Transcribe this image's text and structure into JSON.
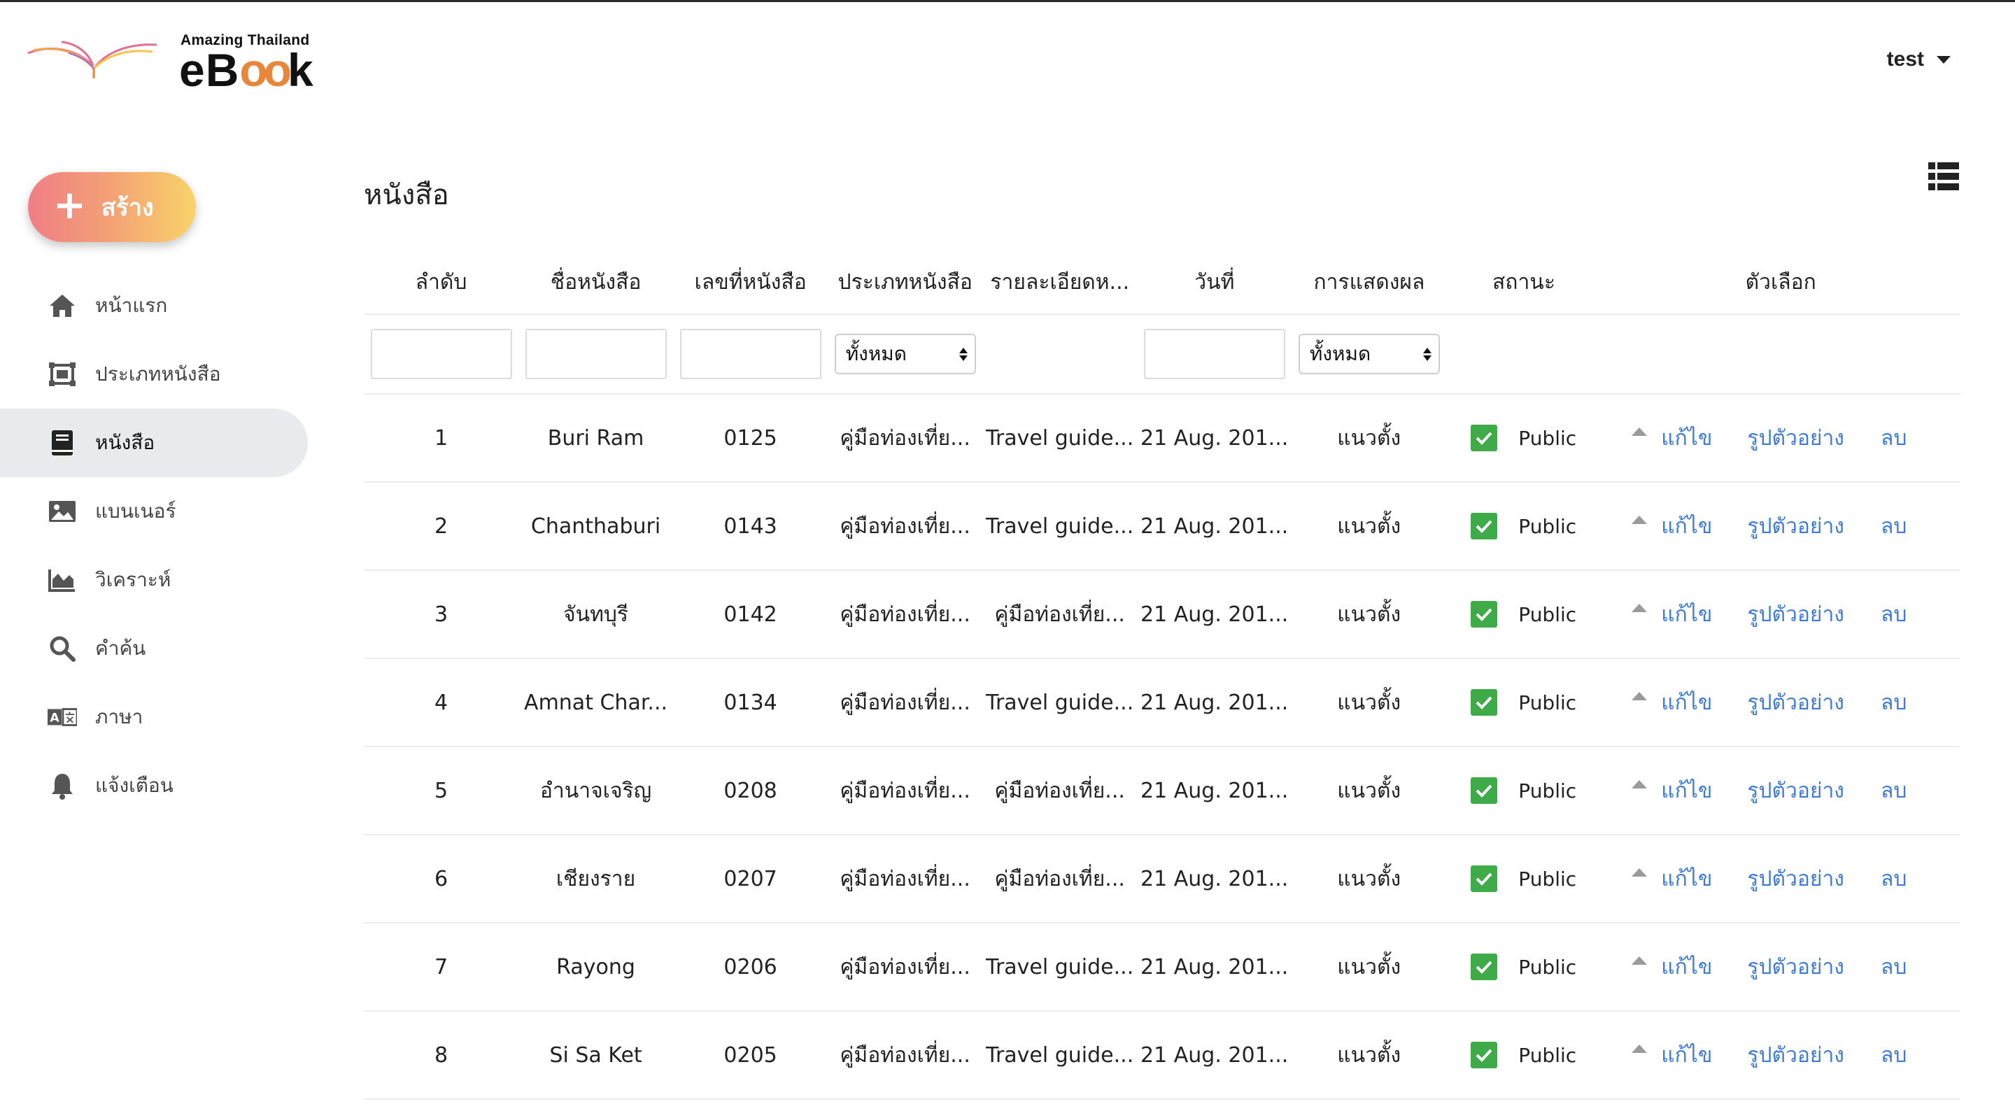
{
  "header": {
    "logo_small": "Amazing Thailand",
    "logo_big_1": "eB",
    "logo_big_oo": "oo",
    "logo_big_2": "k",
    "user": "test"
  },
  "sidebar": {
    "create_label": "สร้าง",
    "items": [
      {
        "label": "หน้าแรก",
        "icon": "home-icon"
      },
      {
        "label": "ประเภทหนังสือ",
        "icon": "book-category-icon"
      },
      {
        "label": "หนังสือ",
        "icon": "book-icon",
        "active": true
      },
      {
        "label": "แบนเนอร์",
        "icon": "image-icon"
      },
      {
        "label": "วิเคราะห์",
        "icon": "area-chart-icon"
      },
      {
        "label": "คำค้น",
        "icon": "search-icon"
      },
      {
        "label": "ภาษา",
        "icon": "translate-icon"
      },
      {
        "label": "แจ้งเตือน",
        "icon": "bell-icon"
      }
    ]
  },
  "main": {
    "title": "หนังสือ",
    "columns": [
      "ลำดับ",
      "ชื่อหนังสือ",
      "เลขที่หนังสือ",
      "ประเภทหนังสือ",
      "รายละเอียดห...",
      "วันที่",
      "การแสดงผล",
      "สถานะ",
      "ตัวเลือก"
    ],
    "filter_select_1": "ทั้งหมด",
    "filter_select_2": "ทั้งหมด",
    "actions": {
      "edit": "แก้ไข",
      "preview": "รูปตัวอย่าง",
      "delete": "ลบ"
    },
    "rows": [
      {
        "no": "1",
        "name": "Buri Ram",
        "code": "0125",
        "type": "คู่มือท่องเที่ย...",
        "detail": "Travel guide...",
        "date": "21 Aug. 201...",
        "display": "แนวตั้ง",
        "status": "Public"
      },
      {
        "no": "2",
        "name": "Chanthaburi",
        "code": "0143",
        "type": "คู่มือท่องเที่ย...",
        "detail": "Travel guide...",
        "date": "21 Aug. 201...",
        "display": "แนวตั้ง",
        "status": "Public"
      },
      {
        "no": "3",
        "name": "จันทบุรี",
        "code": "0142",
        "type": "คู่มือท่องเที่ย...",
        "detail": "คู่มือท่องเที่ย...",
        "date": "21 Aug. 201...",
        "display": "แนวตั้ง",
        "status": "Public"
      },
      {
        "no": "4",
        "name": "Amnat Char...",
        "code": "0134",
        "type": "คู่มือท่องเที่ย...",
        "detail": "Travel guide...",
        "date": "21 Aug. 201...",
        "display": "แนวตั้ง",
        "status": "Public"
      },
      {
        "no": "5",
        "name": "อำนาจเจริญ",
        "code": "0208",
        "type": "คู่มือท่องเที่ย...",
        "detail": "คู่มือท่องเที่ย...",
        "date": "21 Aug. 201...",
        "display": "แนวตั้ง",
        "status": "Public"
      },
      {
        "no": "6",
        "name": "เชียงราย",
        "code": "0207",
        "type": "คู่มือท่องเที่ย...",
        "detail": "คู่มือท่องเที่ย...",
        "date": "21 Aug. 201...",
        "display": "แนวตั้ง",
        "status": "Public"
      },
      {
        "no": "7",
        "name": "Rayong",
        "code": "0206",
        "type": "คู่มือท่องเที่ย...",
        "detail": "Travel guide...",
        "date": "21 Aug. 201...",
        "display": "แนวตั้ง",
        "status": "Public"
      },
      {
        "no": "8",
        "name": "Si Sa Ket",
        "code": "0205",
        "type": "คู่มือท่องเที่ย...",
        "detail": "Travel guide...",
        "date": "21 Aug. 201...",
        "display": "แนวตั้ง",
        "status": "Public"
      }
    ]
  },
  "colors": {
    "accent_link": "#3d7bd6",
    "status_green": "#3eaa48",
    "active_nav_bg": "#e9eaed"
  }
}
